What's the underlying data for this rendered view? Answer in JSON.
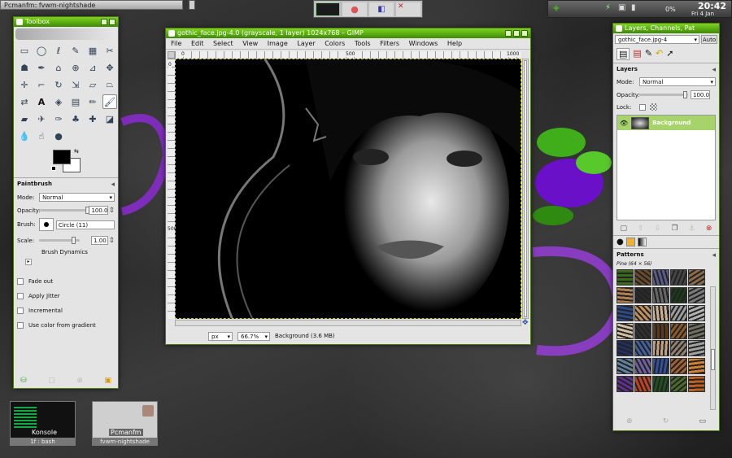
{
  "taskbar": {
    "pcmanfm_task": "Pcmanfm: fvwm-nightshade",
    "clock_time": "20:42",
    "clock_date": "Fri  4 Jan",
    "battery": "0%"
  },
  "toolbox": {
    "title": "Toolbox",
    "paintbrush": {
      "title": "Paintbrush",
      "mode_label": "Mode:",
      "mode_value": "Normal",
      "opacity_label": "Opacity:",
      "opacity_value": "100.0",
      "brush_label": "Brush:",
      "brush_value": "Circle (11)",
      "scale_label": "Scale:",
      "scale_value": "1.00",
      "dynamics_label": "Brush Dynamics",
      "fade_out": "Fade out",
      "apply_jitter": "Apply Jitter",
      "incremental": "Incremental",
      "use_color_gradient": "Use color from gradient"
    }
  },
  "image_window": {
    "title": "gothic_face.jpg-4.0 (grayscale, 1 layer) 1024x768 – GIMP",
    "menu": [
      "File",
      "Edit",
      "Select",
      "View",
      "Image",
      "Layer",
      "Colors",
      "Tools",
      "Filters",
      "Windows",
      "Help"
    ],
    "ruler_top": [
      "0",
      "500",
      "1000"
    ],
    "ruler_left": [
      "0",
      "500"
    ],
    "status": {
      "unit": "px",
      "zoom": "66.7%",
      "layer_info": "Background (3.6 MB)"
    }
  },
  "layers": {
    "title": "Layers, Channels, Pat",
    "image_select": "gothic_face.jpg-4",
    "auto_button": "Auto",
    "heading": "Layers",
    "mode_label": "Mode:",
    "mode_value": "Normal",
    "opacity_label": "Opacity:",
    "opacity_value": "100.0",
    "lock_label": "Lock:",
    "layer_name": "Background"
  },
  "patterns": {
    "heading": "Patterns",
    "current": "Pine (64 × 56)",
    "swatches": [
      "#3a6b1a",
      "#6b4a2a",
      "#5a5a8a",
      "#444",
      "#8a6a4a",
      "#b08050",
      "#2a2a2a",
      "#666",
      "#1a3a1a",
      "#7a7a7a",
      "#2a4a8a",
      "#c09060",
      "#c8b090",
      "#9a9a9a",
      "#b0b0b0",
      "#d0c0a0",
      "#303030",
      "#5a3a1a",
      "#8a5a2a",
      "#707060",
      "#203060",
      "#4060a0",
      "#c0a080",
      "#908070",
      "#a0a0a0",
      "#6080a0",
      "#7060a0",
      "#3050a0",
      "#a06030",
      "#d08030",
      "#603090",
      "#c04020",
      "#205020",
      "#4a6a2a",
      "#c06020",
      "#e0a040",
      "#30a030",
      "#806040",
      "#e08020",
      "#a06020",
      "#e0d0c0",
      "#707070",
      "#404080",
      "#a040c0",
      "#d0b0d0",
      "#c0c080",
      "#4070c0",
      "#6a3aa0"
    ]
  },
  "desktop_thumbs": {
    "konsole": "Konsole",
    "konsole_sub": "1f : bash",
    "pcmanfm": "Pcmanfm",
    "pcmanfm_sub": "fvwm-nightshade"
  }
}
